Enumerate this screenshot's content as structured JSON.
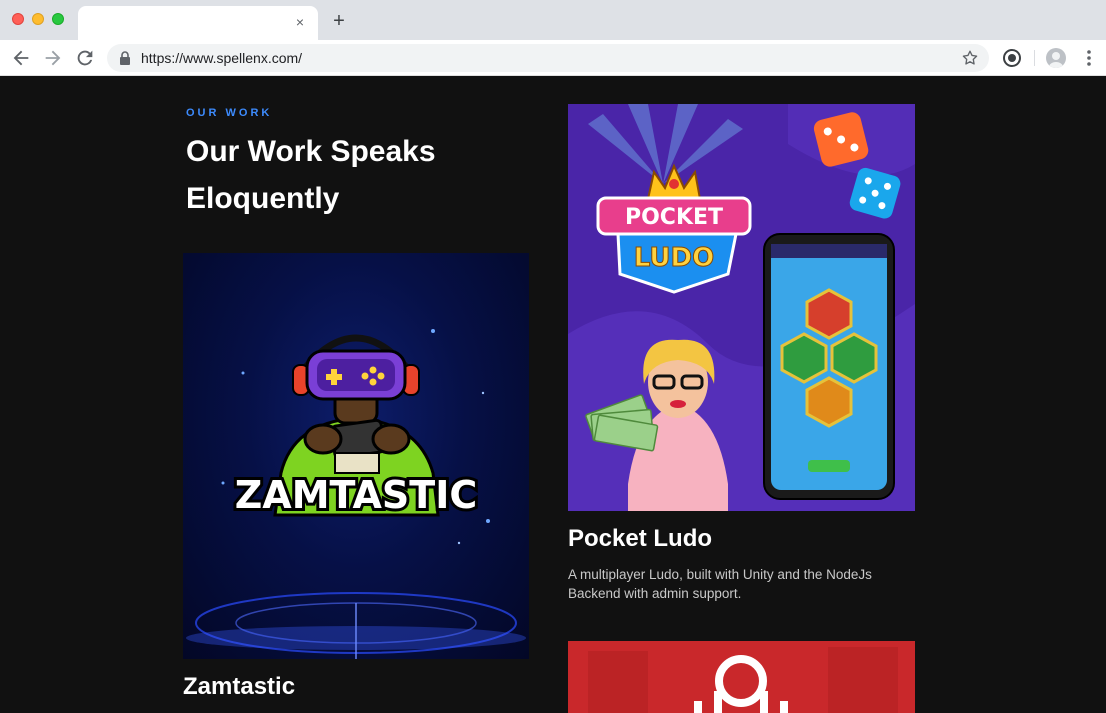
{
  "browser": {
    "url": "https://www.spellenx.com/",
    "new_tab_symbol": "+",
    "close_tab_symbol": "×"
  },
  "section": {
    "eyebrow": "OUR WORK",
    "heading": "Our Work Speaks Eloquently"
  },
  "projects": [
    {
      "title": "Zamtastic",
      "description": "",
      "image_logo_text": "ZAMTASTIC"
    },
    {
      "title": "Pocket Ludo",
      "description": "A multiplayer Ludo, built with Unity and the NodeJs Backend with admin support.",
      "image_logo_text": "POCKET LUDO"
    },
    {
      "title": "",
      "description": ""
    }
  ],
  "colors": {
    "page_bg": "#111111",
    "accent": "#3d8bfd",
    "ludo_purple": "#4a25a8",
    "third_card_red": "#c9282b"
  },
  "icons": [
    "back-arrow-icon",
    "forward-arrow-icon",
    "reload-icon",
    "lock-icon",
    "star-icon",
    "extension-icon",
    "account-icon",
    "menu-dots-icon",
    "close-icon",
    "plus-icon"
  ]
}
